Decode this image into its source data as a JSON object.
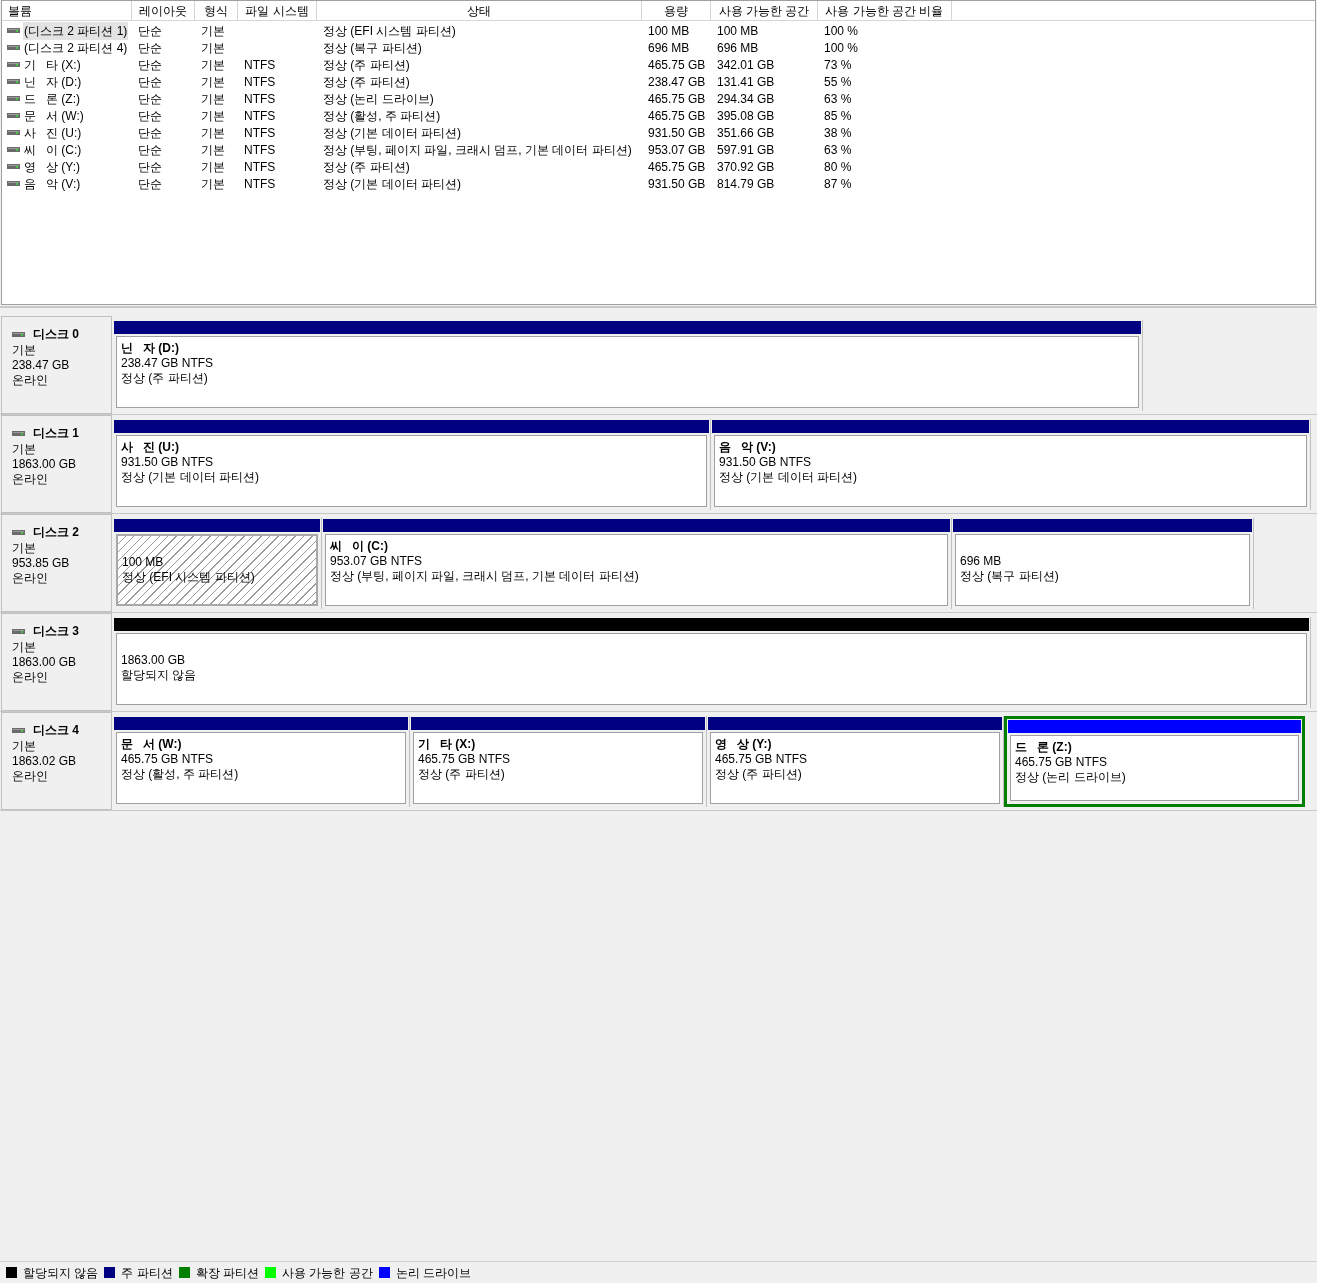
{
  "columns": [
    "볼륨",
    "레이아웃",
    "형식",
    "파일 시스템",
    "상태",
    "용량",
    "사용 가능한 공간",
    "사용 가능한 공간 비율"
  ],
  "volumes": [
    {
      "name": "(디스크 2 파티션 1)",
      "layout": "단순",
      "type": "기본",
      "status": "정상 (EFI 시스템 파티션)",
      "capacity": "100 MB",
      "free": "100 MB",
      "free_pct": "100 %",
      "selected": true
    },
    {
      "name": "(디스크 2 파티션 4)",
      "layout": "단순",
      "type": "기본",
      "status": "정상 (복구 파티션)",
      "capacity": "696 MB",
      "free": "696 MB",
      "free_pct": "100 %",
      "selected": false
    },
    {
      "name": "기   타 (X:)",
      "layout": "단순",
      "type": "기본",
      "fs": "NTFS",
      "status": "정상 (주 파티션)",
      "capacity": "465.75 GB",
      "free": "342.01 GB",
      "free_pct": "73 %",
      "selected": false
    },
    {
      "name": "닌   자 (D:)",
      "layout": "단순",
      "type": "기본",
      "fs": "NTFS",
      "status": "정상 (주 파티션)",
      "capacity": "238.47 GB",
      "free": "131.41 GB",
      "free_pct": "55 %",
      "selected": false
    },
    {
      "name": "드   론 (Z:)",
      "layout": "단순",
      "type": "기본",
      "fs": "NTFS",
      "status": "정상 (논리 드라이브)",
      "capacity": "465.75 GB",
      "free": "294.34 GB",
      "free_pct": "63 %",
      "selected": false
    },
    {
      "name": "문   서 (W:)",
      "layout": "단순",
      "type": "기본",
      "fs": "NTFS",
      "status": "정상 (활성, 주 파티션)",
      "capacity": "465.75 GB",
      "free": "395.08 GB",
      "free_pct": "85 %",
      "selected": false
    },
    {
      "name": "사   진 (U:)",
      "layout": "단순",
      "type": "기본",
      "fs": "NTFS",
      "status": "정상 (기본 데이터 파티션)",
      "capacity": "931.50 GB",
      "free": "351.66 GB",
      "free_pct": "38 %",
      "selected": false
    },
    {
      "name": "씨   이 (C:)",
      "layout": "단순",
      "type": "기본",
      "fs": "NTFS",
      "status": "정상 (부팅, 페이지 파일, 크래시 덤프, 기본 데이터 파티션)",
      "capacity": "953.07 GB",
      "free": "597.91 GB",
      "free_pct": "63 %",
      "selected": false
    },
    {
      "name": "영   상 (Y:)",
      "layout": "단순",
      "type": "기본",
      "fs": "NTFS",
      "status": "정상 (주 파티션)",
      "capacity": "465.75 GB",
      "free": "370.92 GB",
      "free_pct": "80 %",
      "selected": false
    },
    {
      "name": "음   악 (V:)",
      "layout": "단순",
      "type": "기본",
      "fs": "NTFS",
      "status": "정상 (기본 데이터 파티션)",
      "capacity": "931.50 GB",
      "free": "814.79 GB",
      "free_pct": "87 %",
      "selected": false
    }
  ],
  "disks": [
    {
      "title": "디스크 0",
      "type": "기본",
      "size": "238.47 GB",
      "state": "온라인",
      "partitions": [
        {
          "kind": "primary",
          "name": "닌   자 (D:)",
          "size": "238.47 GB NTFS",
          "status": "정상 (주 파티션)",
          "selected": false,
          "in_extended": false
        }
      ]
    },
    {
      "title": "디스크 1",
      "type": "기본",
      "size": "1863.00 GB",
      "state": "온라인",
      "partitions": [
        {
          "kind": "primary",
          "name": "사   진 (U:)",
          "size": "931.50 GB NTFS",
          "status": "정상 (기본 데이터 파티션)",
          "selected": false,
          "in_extended": false
        },
        {
          "kind": "primary",
          "name": "음   악 (V:)",
          "size": "931.50 GB NTFS",
          "status": "정상 (기본 데이터 파티션)",
          "selected": false,
          "in_extended": false
        }
      ]
    },
    {
      "title": "디스크 2",
      "type": "기본",
      "size": "953.85 GB",
      "state": "온라인",
      "partitions": [
        {
          "kind": "primary",
          "size": "100 MB",
          "status": "정상 (EFI 시스템 파티션)",
          "selected": true,
          "in_extended": false
        },
        {
          "kind": "primary",
          "name": "씨   이 (C:)",
          "size": "953.07 GB NTFS",
          "status": "정상 (부팅, 페이지 파일, 크래시 덤프, 기본 데이터 파티션)",
          "selected": false,
          "in_extended": false
        },
        {
          "kind": "primary",
          "size": "696 MB",
          "status": "정상 (복구 파티션)",
          "selected": false,
          "in_extended": false
        }
      ]
    },
    {
      "title": "디스크 3",
      "type": "기본",
      "size": "1863.00 GB",
      "state": "온라인",
      "partitions": [
        {
          "kind": "unallocated",
          "size": "1863.00 GB",
          "status": "할당되지 않음",
          "selected": false,
          "in_extended": false
        }
      ]
    },
    {
      "title": "디스크 4",
      "type": "기본",
      "size": "1863.02 GB",
      "state": "온라인",
      "partitions": [
        {
          "kind": "primary",
          "name": "문   서 (W:)",
          "size": "465.75 GB NTFS",
          "status": "정상 (활성, 주 파티션)",
          "selected": false,
          "in_extended": false
        },
        {
          "kind": "primary",
          "name": "기   타 (X:)",
          "size": "465.75 GB NTFS",
          "status": "정상 (주 파티션)",
          "selected": false,
          "in_extended": false
        },
        {
          "kind": "primary",
          "name": "영   상 (Y:)",
          "size": "465.75 GB NTFS",
          "status": "정상 (주 파티션)",
          "selected": false,
          "in_extended": false
        },
        {
          "kind": "logical",
          "name": "드   론 (Z:)",
          "size": "465.75 GB NTFS",
          "status": "정상 (논리 드라이브)",
          "selected": false,
          "in_extended": true
        }
      ]
    }
  ],
  "legend": [
    {
      "label": "할당되지 않음",
      "color": "#000000"
    },
    {
      "label": "주 파티션",
      "color": "#000080"
    },
    {
      "label": "확장 파티션",
      "color": "#008000"
    },
    {
      "label": "사용 가능한 공간",
      "color": "#00ff00"
    },
    {
      "label": "논리 드라이브",
      "color": "#0000ff"
    }
  ]
}
